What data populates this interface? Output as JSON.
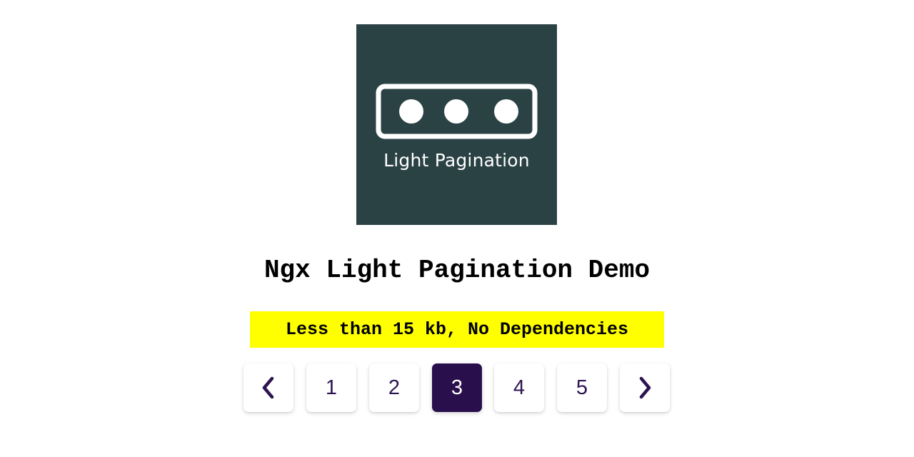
{
  "logo": {
    "text": "Light Pagination",
    "background": "#2b4244"
  },
  "title": "Ngx Light Pagination Demo",
  "tagline": "Less than 15 kb, No Dependencies",
  "pagination": {
    "prev_icon": "chevron-left-icon",
    "next_icon": "chevron-right-icon",
    "pages": [
      "1",
      "2",
      "3",
      "4",
      "5"
    ],
    "current_page": "3",
    "accent": "#2a0f4d"
  }
}
